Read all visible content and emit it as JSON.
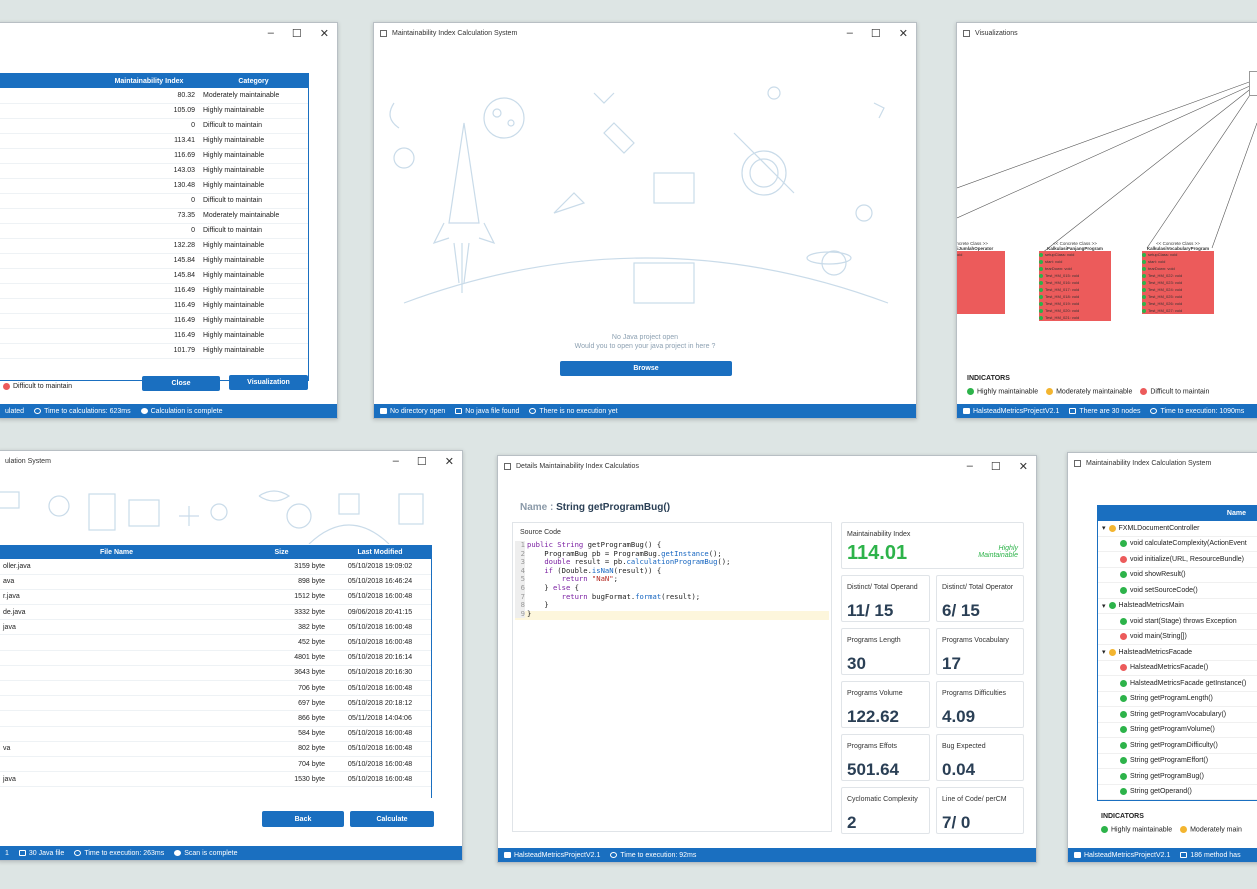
{
  "win1": {
    "col_mi": "Maintainability Index",
    "col_cat": "Category",
    "rows": [
      [
        "80.32",
        "Moderately maintainable"
      ],
      [
        "105.09",
        "Highly maintainable"
      ],
      [
        "0",
        "Difficult to maintain"
      ],
      [
        "113.41",
        "Highly maintainable"
      ],
      [
        "116.69",
        "Highly maintainable"
      ],
      [
        "143.03",
        "Highly maintainable"
      ],
      [
        "130.48",
        "Highly maintainable"
      ],
      [
        "0",
        "Difficult to maintain"
      ],
      [
        "73.35",
        "Moderately maintainable"
      ],
      [
        "0",
        "Difficult to maintain"
      ],
      [
        "132.28",
        "Highly maintainable"
      ],
      [
        "145.84",
        "Highly maintainable"
      ],
      [
        "145.84",
        "Highly maintainable"
      ],
      [
        "116.49",
        "Highly maintainable"
      ],
      [
        "116.49",
        "Highly maintainable"
      ],
      [
        "116.49",
        "Highly maintainable"
      ],
      [
        "116.49",
        "Highly maintainable"
      ],
      [
        "101.79",
        "Highly maintainable"
      ]
    ],
    "legend_difficult": "Difficult to maintain",
    "close": "Close",
    "visualization": "Visualization",
    "status": [
      "ulated",
      "Time to calculations: 623ms",
      "Calculation is complete"
    ]
  },
  "win2": {
    "title": "Maintainability Index Calculation System",
    "msg1": "No Java project open",
    "msg2": "Would you to open your java project in here ?",
    "browse": "Browse",
    "status": [
      "No directory open",
      "No java file found",
      "There is no execution yet"
    ]
  },
  "win3": {
    "title": "Visualizations",
    "indicators": "INDICATORS",
    "high": "Highly maintainable",
    "mod": "Moderately maintainable",
    "diff": "Difficult to maintain",
    "status": [
      "HalsteadMetricsProjectV2.1",
      "There are 30 nodes",
      "Time to execution: 1090ms"
    ],
    "classes": [
      {
        "stereo": "<< Concrete Class >>",
        "name": "KalkulasiJumlahOperator",
        "rows": [
          "setupClass: void",
          "void",
          "void",
          "void",
          "void",
          "void",
          "void",
          "void",
          "void"
        ]
      },
      {
        "stereo": "<< Concrete Class >>",
        "name": "KalkulasiPanjangProgram",
        "rows": [
          "setupClass: void",
          "start: void",
          "tearDown: void",
          "Test_HM_015: void",
          "Test_HM_016: void",
          "Test_HM_017: void",
          "Test_HM_018: void",
          "Test_HM_019: void",
          "Test_HM_020: void",
          "Test_HM_021: void"
        ]
      },
      {
        "stereo": "<< Concrete Class >>",
        "name": "KalkulasiVocabularyProgram",
        "rows": [
          "setupClass: void",
          "start: void",
          "tearDown: void",
          "Test_HM_022: void",
          "Test_HM_023: void",
          "Test_HM_024: void",
          "Test_HM_025: void",
          "Test_HM_026: void",
          "Test_HM_027: void"
        ]
      }
    ]
  },
  "win4": {
    "title": "ulation System",
    "col_name": "File Name",
    "col_size": "Size",
    "col_mod": "Last Modified",
    "rows": [
      [
        "oller.java",
        "3159 byte",
        "05/10/2018 19:09:02"
      ],
      [
        "ava",
        "898 byte",
        "05/10/2018 16:46:24"
      ],
      [
        "r.java",
        "1512 byte",
        "05/10/2018 16:00:48"
      ],
      [
        "de.java",
        "3332 byte",
        "09/06/2018 20:41:15"
      ],
      [
        "java",
        "382 byte",
        "05/10/2018 16:00:48"
      ],
      [
        "",
        "452 byte",
        "05/10/2018 16:00:48"
      ],
      [
        "",
        "4801 byte",
        "05/10/2018 20:16:14"
      ],
      [
        "",
        "3643 byte",
        "05/10/2018 20:16:30"
      ],
      [
        "",
        "706 byte",
        "05/10/2018 16:00:48"
      ],
      [
        "",
        "697 byte",
        "05/10/2018 20:18:12"
      ],
      [
        "",
        "866 byte",
        "05/11/2018 14:04:06"
      ],
      [
        "",
        "584 byte",
        "05/10/2018 16:00:48"
      ],
      [
        "va",
        "802 byte",
        "05/10/2018 16:00:48"
      ],
      [
        "",
        "704 byte",
        "05/10/2018 16:00:48"
      ],
      [
        "java",
        "1530 byte",
        "05/10/2018 16:00:48"
      ]
    ],
    "back": "Back",
    "calculate": "Calculate",
    "status": [
      "1",
      "30 Java file",
      "Time to execution: 263ms",
      "Scan is complete"
    ]
  },
  "win5": {
    "title": "Details Maintainability Index Calculatios",
    "name_label": "Name :",
    "name_value": "String getProgramBug()",
    "source_label": "Source Code",
    "mi_label": "Maintainability Index",
    "mi_value": "114.01",
    "mi_cat1": "Highly",
    "mi_cat2": "Maintainable",
    "cards": [
      [
        "Distinct/ Total Operand",
        "11/ 15"
      ],
      [
        "Distinct/ Total Operator",
        "6/ 15"
      ],
      [
        "Programs Length",
        "30"
      ],
      [
        "Programs Vocabulary",
        "17"
      ],
      [
        "Programs Volume",
        "122.62"
      ],
      [
        "Programs Difficulties",
        "4.09"
      ],
      [
        "Programs Effots",
        "501.64"
      ],
      [
        "Bug Expected",
        "0.04"
      ],
      [
        "Cyclomatic Complexity",
        "2"
      ],
      [
        "Line of Code/ perCM",
        "7/ 0"
      ]
    ],
    "status": [
      "HalsteadMetricsProjectV2.1",
      "Time to execution: 92ms"
    ]
  },
  "win6": {
    "title": "Maintainability Index Calculation System",
    "col_name": "Name",
    "tree": [
      [
        "FXMLDocumentController",
        "y",
        0
      ],
      [
        "void calculateComplexity(ActionEvent",
        "g",
        1
      ],
      [
        "void initialize(URL, ResourceBundle)",
        "r",
        1
      ],
      [
        "void showResult()",
        "g",
        1
      ],
      [
        "void setSourceCode()",
        "g",
        1
      ],
      [
        "HalsteadMetricsMain",
        "g",
        0
      ],
      [
        "void start(Stage) throws Exception",
        "g",
        1
      ],
      [
        "void main(String[])",
        "r",
        1
      ],
      [
        "HalsteadMetricsFacade",
        "y",
        0
      ],
      [
        "HalsteadMetricsFacade()",
        "r",
        1
      ],
      [
        "HalsteadMetricsFacade getInstance()",
        "g",
        1
      ],
      [
        "String getProgramLength()",
        "g",
        1
      ],
      [
        "String getProgramVocabulary()",
        "g",
        1
      ],
      [
        "String getProgramVolume()",
        "g",
        1
      ],
      [
        "String getProgramDifficulty()",
        "g",
        1
      ],
      [
        "String getProgramEffort()",
        "g",
        1
      ],
      [
        "String getProgramBug()",
        "g",
        1
      ],
      [
        "String getOperand()",
        "g",
        1
      ]
    ],
    "indicators": "INDICATORS",
    "high": "Highly maintainable",
    "mod": "Moderately main",
    "status": [
      "HalsteadMetricsProjectV2.1",
      "186 method has"
    ]
  },
  "colors": {
    "accent": "#1a6fc0",
    "high": "#2db34a",
    "mod": "#f3b530",
    "diff": "#ec5b5b"
  }
}
